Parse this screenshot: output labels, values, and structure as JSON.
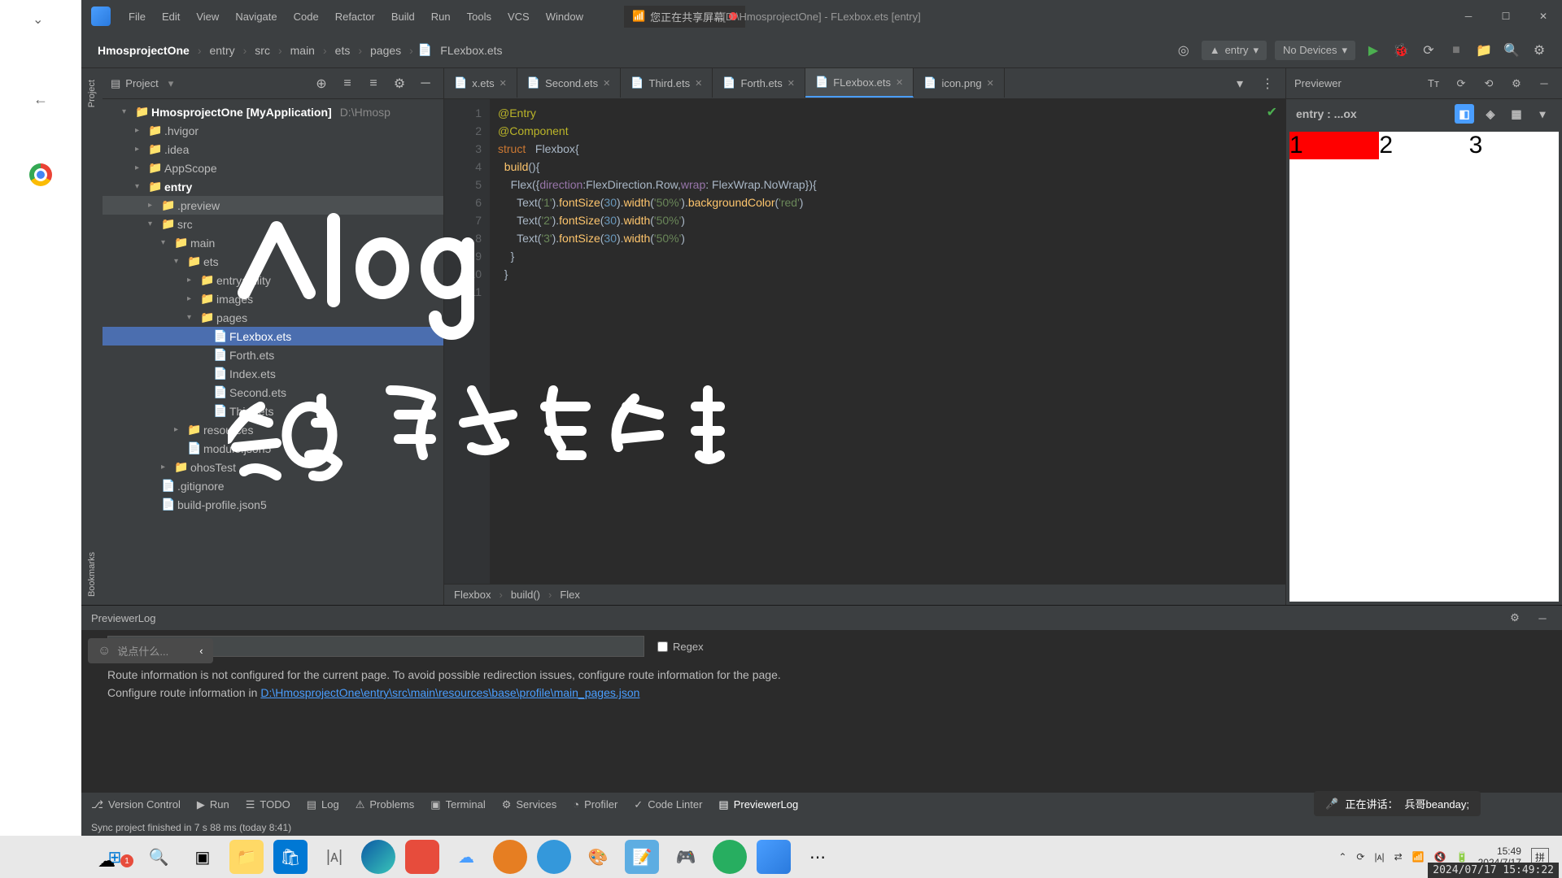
{
  "window": {
    "title": "[D:\\HmosprojectOne] - FLexbox.ets [entry]",
    "share_status": "您正在共享屏幕"
  },
  "menu": [
    "File",
    "Edit",
    "View",
    "Navigate",
    "Code",
    "Refactor",
    "Build",
    "Run",
    "Tools",
    "VCS",
    "Window"
  ],
  "breadcrumb": [
    "HmosprojectOne",
    "entry",
    "src",
    "main",
    "ets",
    "pages",
    "FLexbox.ets"
  ],
  "toolbar": {
    "config": "entry",
    "device": "No Devices"
  },
  "project": {
    "title": "Project",
    "root": "HmosprojectOne [MyApplication]",
    "root_path": "D:\\Hmosp",
    "nodes": [
      {
        "label": ".hvigor",
        "type": "folder",
        "indent": 2
      },
      {
        "label": ".idea",
        "type": "folder",
        "indent": 2
      },
      {
        "label": "AppScope",
        "type": "folder",
        "indent": 2
      },
      {
        "label": "entry",
        "type": "folder",
        "indent": 2,
        "open": true,
        "bold": true
      },
      {
        "label": ".preview",
        "type": "folder",
        "indent": 3,
        "hl": true
      },
      {
        "label": "src",
        "type": "folder",
        "indent": 3,
        "open": true
      },
      {
        "label": "main",
        "type": "folder",
        "indent": 4,
        "open": true
      },
      {
        "label": "ets",
        "type": "folder",
        "indent": 5,
        "open": true
      },
      {
        "label": "entryability",
        "type": "folder",
        "indent": 6
      },
      {
        "label": "images",
        "type": "folder",
        "indent": 6
      },
      {
        "label": "pages",
        "type": "folder",
        "indent": 6,
        "open": true
      },
      {
        "label": "FLexbox.ets",
        "type": "file",
        "indent": 7,
        "sel": true
      },
      {
        "label": "Forth.ets",
        "type": "file",
        "indent": 7
      },
      {
        "label": "Index.ets",
        "type": "file",
        "indent": 7
      },
      {
        "label": "Second.ets",
        "type": "file",
        "indent": 7
      },
      {
        "label": "Third.ets",
        "type": "file",
        "indent": 7
      },
      {
        "label": "resources",
        "type": "folder",
        "indent": 5
      },
      {
        "label": "module.json5",
        "type": "file",
        "indent": 5
      },
      {
        "label": "ohosTest",
        "type": "folder",
        "indent": 4
      },
      {
        "label": ".gitignore",
        "type": "file",
        "indent": 3
      },
      {
        "label": "build-profile.json5",
        "type": "file",
        "indent": 3
      }
    ]
  },
  "tabs": [
    {
      "label": "x.ets"
    },
    {
      "label": "Second.ets"
    },
    {
      "label": "Third.ets"
    },
    {
      "label": "Forth.ets"
    },
    {
      "label": "FLexbox.ets",
      "active": true
    },
    {
      "label": "icon.png"
    }
  ],
  "code": {
    "lines": [
      1,
      2,
      3,
      4,
      5,
      6,
      7,
      8,
      9,
      10,
      11
    ],
    "content": [
      {
        "t": "@Entry",
        "cls": "decor"
      },
      {
        "t": "@Component",
        "cls": "decor"
      },
      {
        "raw": "<span class='struct'>struct</span>   <span class='type'>Flexbox</span><span class='punct'>{</span>"
      },
      {
        "raw": "  <span class='method'>build</span><span class='punct'>(){</span>"
      },
      {
        "raw": "    <span class='type'>Flex</span><span class='punct'>({</span><span class='prop'>direction</span><span class='punct'>:</span><span class='type'>FlexDirection.Row</span><span class='punct'>,</span><span class='prop'>wrap</span><span class='punct'>: </span><span class='type'>FlexWrap.NoWrap</span><span class='punct'>}){</span>"
      },
      {
        "raw": "      <span class='type'>Text</span><span class='punct'>(</span><span class='str'>'1'</span><span class='punct'>).</span><span class='method'>fontSize</span><span class='punct'>(</span><span class='num'>30</span><span class='punct'>).</span><span class='method'>width</span><span class='punct'>(</span><span class='str'>'50%'</span><span class='punct'>).</span><span class='method'>backgroundColor</span><span class='punct'>(</span><span class='str'>'red'</span><span class='punct'>)</span>"
      },
      {
        "raw": "      <span class='type'>Text</span><span class='punct'>(</span><span class='str'>'2'</span><span class='punct'>).</span><span class='method'>fontSize</span><span class='punct'>(</span><span class='num'>30</span><span class='punct'>).</span><span class='method'>width</span><span class='punct'>(</span><span class='str'>'50%'</span><span class='punct'>)</span>"
      },
      {
        "raw": "      <span class='type'>Text</span><span class='punct'>(</span><span class='str'>'3'</span><span class='punct'>).</span><span class='method'>fontSize</span><span class='punct'>(</span><span class='num'>30</span><span class='punct'>).</span><span class='method'>width</span><span class='punct'>(</span><span class='str'>'50%'</span><span class='punct'>)</span>"
      },
      {
        "raw": "    <span class='punct'>}</span>"
      },
      {
        "raw": "  <span class='punct'>}</span>"
      },
      {
        "raw": ""
      }
    ]
  },
  "code_crumb": [
    "Flexbox",
    "build()",
    "Flex"
  ],
  "previewer": {
    "title": "Previewer",
    "entry": "entry : ...ox",
    "items": [
      "1",
      "2",
      "3"
    ]
  },
  "log": {
    "title": "PreviewerLog",
    "regex_label": "Regex",
    "msg1": "Route information is not configured for the current page. To avoid possible redirection issues, configure route information for the page.",
    "msg2_prefix": "Configure route information in ",
    "msg2_link": "D:\\HmosprojectOne\\entry\\src\\main\\resources\\base\\profile\\main_pages.json"
  },
  "bottom_tabs": [
    "Version Control",
    "Run",
    "TODO",
    "Log",
    "Problems",
    "Terminal",
    "Services",
    "Profiler",
    "Code Linter",
    "PreviewerLog"
  ],
  "status": {
    "sync": "Sync project finished in 7 s 88 ms (today 8:41)"
  },
  "chat": {
    "placeholder": "说点什么...",
    "speaking_label": "正在讲话：",
    "speaker": "兵哥beanday;"
  },
  "clock": {
    "time": "15:49",
    "date": "2024/7/17"
  },
  "timestamp": "2024/07/17 15:49:22",
  "notif_count": "1"
}
